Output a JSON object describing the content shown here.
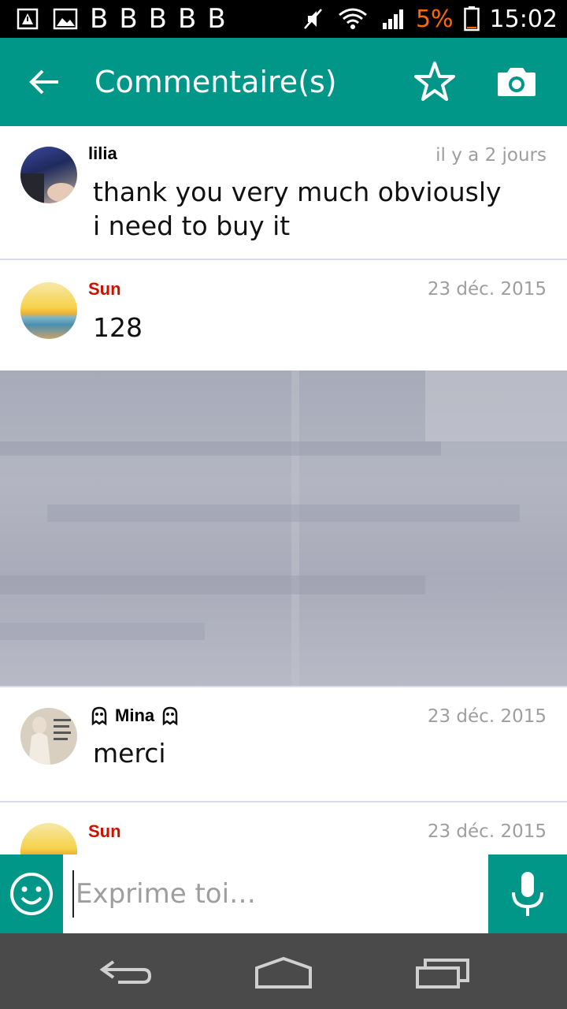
{
  "status_bar": {
    "b_icons": [
      "B",
      "B",
      "B",
      "B",
      "B"
    ],
    "battery_percent": "5%",
    "time": "15:02",
    "icons": [
      "warning-battery-icon",
      "image-icon",
      "mute-icon",
      "wifi-icon",
      "signal-icon",
      "battery-icon"
    ]
  },
  "toolbar": {
    "title": "Commentaire(s)",
    "icons": [
      "back-arrow-icon",
      "star-icon",
      "camera-icon"
    ]
  },
  "comments": [
    {
      "name": "lilia",
      "date": "il y a 2 jours",
      "text": "thank you very much obviously i need to buy it",
      "name_color": "#111111"
    },
    {
      "name": "Sun",
      "date": "23 déc. 2015",
      "text": "128",
      "name_color": "#cc1100",
      "has_image": true
    },
    {
      "name": "Mina",
      "date": "23 déc. 2015",
      "text": "merci",
      "name_color": "#111111"
    },
    {
      "name": "Sun",
      "date": "23 déc. 2015",
      "text": "",
      "name_color": "#cc1100"
    }
  ],
  "input": {
    "placeholder": "Exprime toi…",
    "value": ""
  },
  "colors": {
    "accent": "#009688",
    "status_bar_bg": "#000000",
    "nav_bar_bg": "#4a4a4a",
    "battery_low": "#ff6a00"
  }
}
